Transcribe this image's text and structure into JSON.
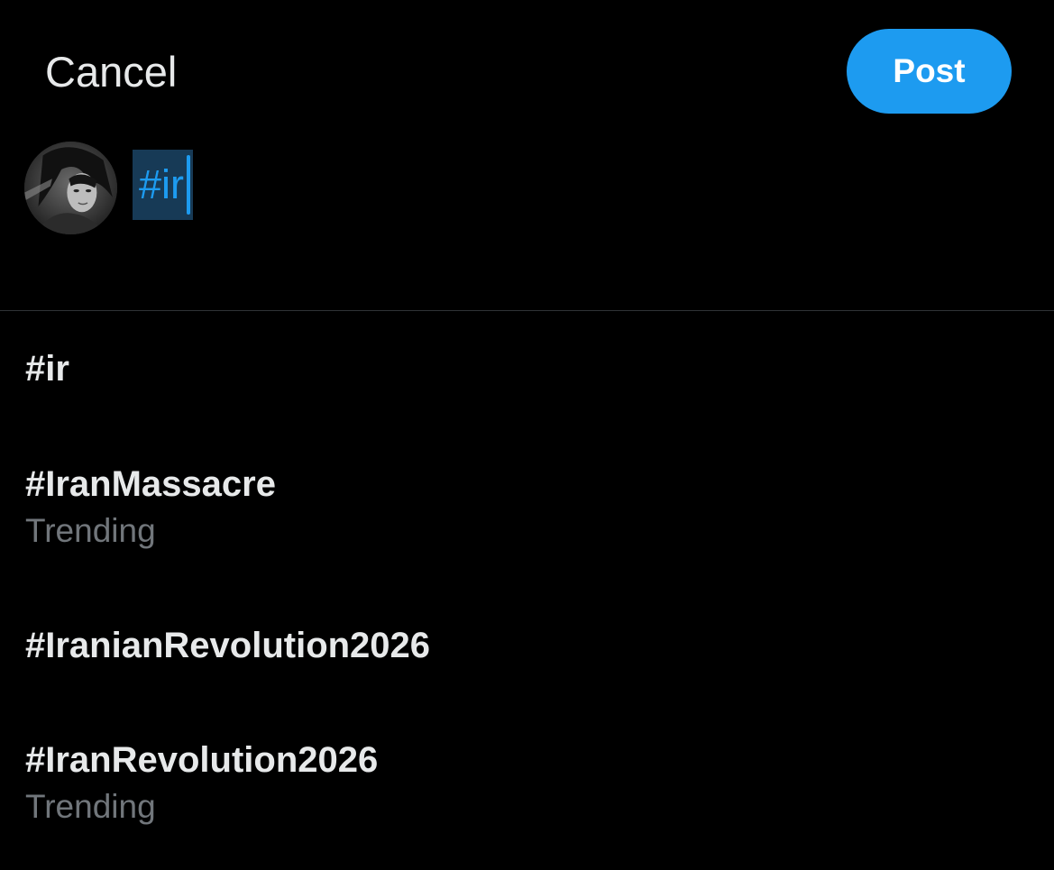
{
  "header": {
    "cancel_label": "Cancel",
    "post_label": "Post"
  },
  "composer": {
    "text": "#ir"
  },
  "colors": {
    "background": "#000000",
    "accent": "#1d9bf0",
    "primary_text": "#e7e9ea",
    "secondary_text": "#71767b",
    "divider": "#2f3336",
    "selection": "#173a56"
  },
  "suggestions": [
    {
      "tag": "#ir",
      "meta": ""
    },
    {
      "tag": "#IranMassacre",
      "meta": "Trending"
    },
    {
      "tag": "#IranianRevolution2026",
      "meta": ""
    },
    {
      "tag": "#IranRevolution2026",
      "meta": "Trending"
    }
  ]
}
